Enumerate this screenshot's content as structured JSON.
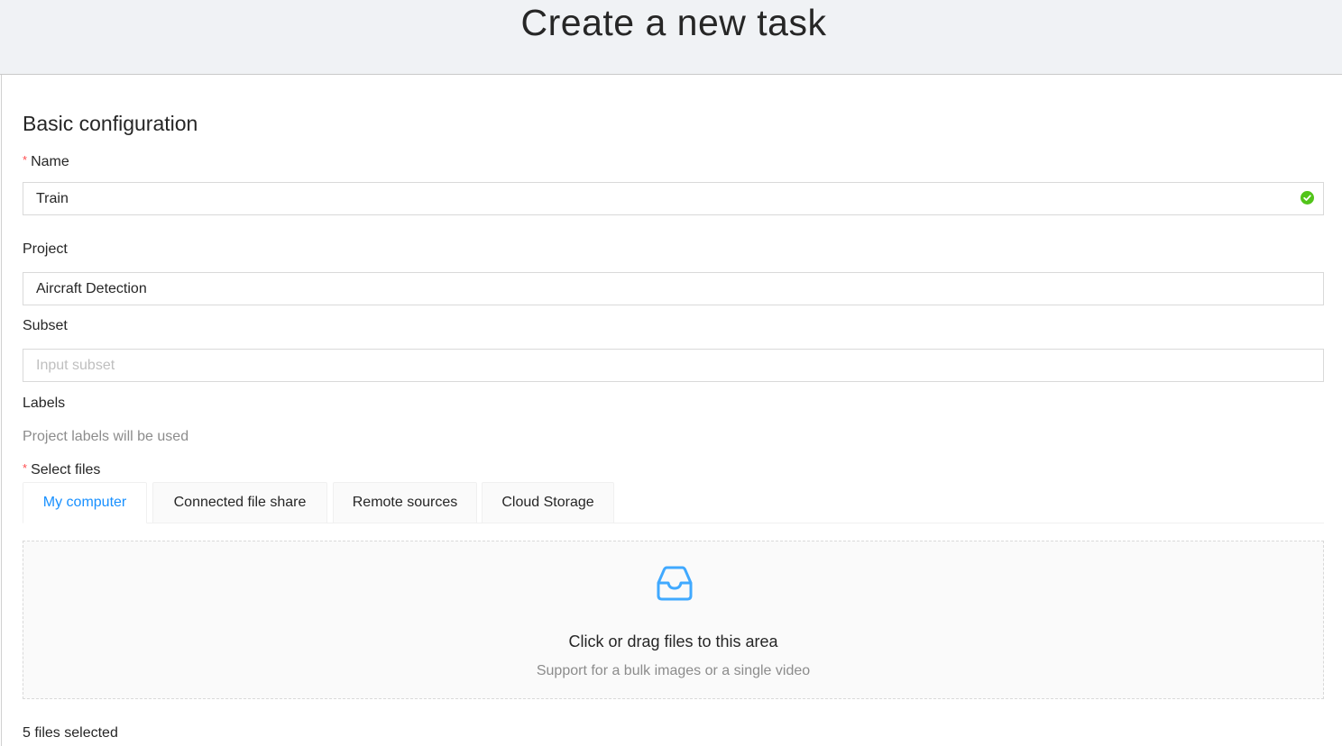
{
  "header": {
    "title": "Create a new task"
  },
  "basic": {
    "section_title": "Basic configuration",
    "name": {
      "label": "Name",
      "required_mark": "*",
      "value": "Train"
    },
    "project": {
      "label": "Project",
      "value": "Aircraft Detection"
    },
    "subset": {
      "label": "Subset",
      "placeholder": "Input subset",
      "value": ""
    },
    "labels": {
      "label": "Labels",
      "hint": "Project labels will be used"
    }
  },
  "files": {
    "label": "Select files",
    "required_mark": "*",
    "tabs": [
      {
        "label": "My computer",
        "active": true
      },
      {
        "label": "Connected file share",
        "active": false
      },
      {
        "label": "Remote sources",
        "active": false
      },
      {
        "label": "Cloud Storage",
        "active": false
      }
    ],
    "dropzone": {
      "icon": "inbox-icon",
      "text": "Click or drag files to this area",
      "hint": "Support for a bulk images or a single video"
    },
    "selected_count_text": "5 files selected"
  },
  "colors": {
    "accent": "#1890ff",
    "valid": "#52c41a",
    "required": "#ff4d4f",
    "header_bg": "#f0f2f5"
  }
}
